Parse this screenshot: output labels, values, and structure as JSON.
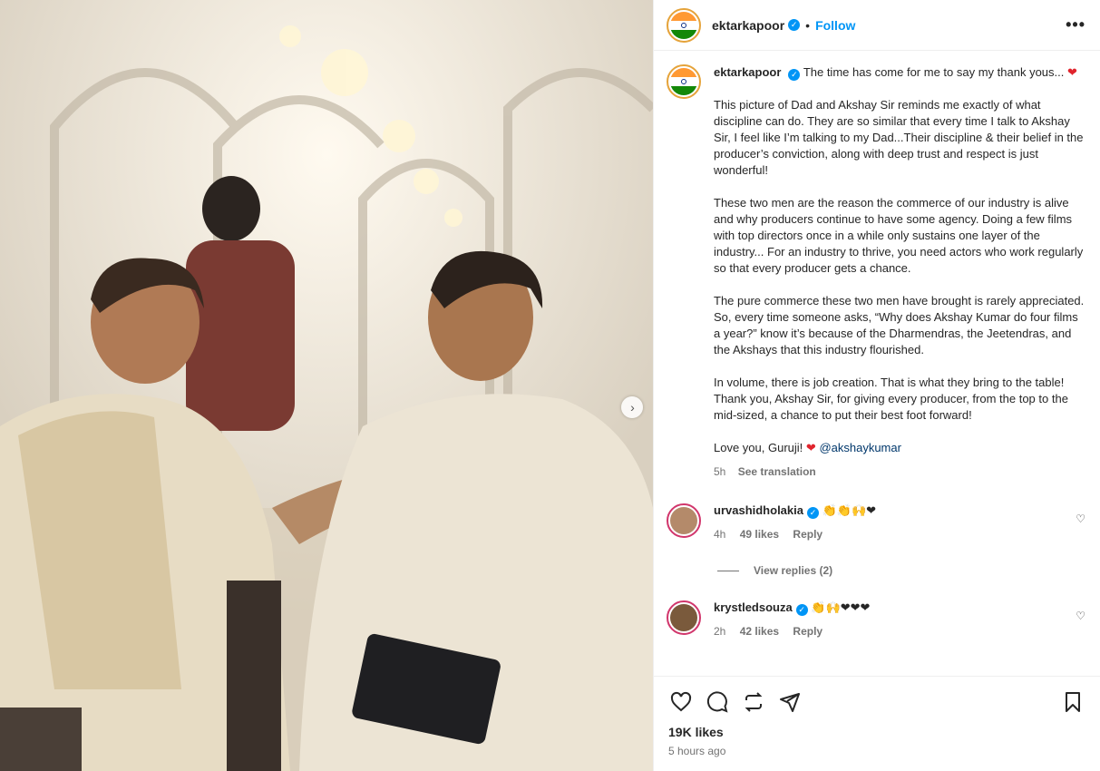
{
  "post": {
    "username": "ektarkapoor",
    "follow_label": "Follow",
    "more_label": "•••",
    "separator": "•"
  },
  "caption": {
    "username": "ektarkapoor",
    "first_line": "The time has come for me to say my thank yous...",
    "heart": "❤",
    "paragraphs": [
      "This picture of Dad and Akshay Sir reminds me exactly of what discipline can do. They are so similar that every time I talk to Akshay Sir, I feel like I’m talking to my Dad...Their discipline & their belief in the producer’s conviction, along with deep trust and respect is just wonderful!",
      "These two men are the reason the commerce of our industry is alive and why producers continue to have some agency. Doing a few films with top directors once in a while only sustains one layer of the industry... For an industry to thrive, you need actors who work regularly so that every producer gets a chance.",
      "The pure commerce these two men have brought is rarely appreciated. So, every time someone asks, “Why does Akshay Kumar do four films a year?” know it’s because of the Dharmendras, the Jeetendras, and the Akshays that this industry flourished.",
      "In volume, there is job creation. That is what they bring to the table! Thank you, Akshay Sir, for giving every producer, from the top to the mid-sized, a chance to put their best foot forward!"
    ],
    "closing": "Love you, Guruji!",
    "mention": "@akshaykumar",
    "age": "5h",
    "see_translation": "See translation"
  },
  "comments": [
    {
      "username": "urvashidholakia",
      "text": "👏👏🙌❤",
      "age": "4h",
      "likes": "49 likes",
      "reply": "Reply",
      "avatar_color": "#b48a6a"
    },
    {
      "username": "krystledsouza",
      "text": "👏🙌❤❤❤",
      "age": "2h",
      "likes": "42 likes",
      "reply": "Reply",
      "avatar_color": "#7a5a3c"
    }
  ],
  "view_replies": "View replies (2)",
  "footer": {
    "likes": "19K likes",
    "time": "5 hours ago"
  },
  "colors": {
    "accent": "#0095f6",
    "heart": "#e0242d",
    "muted": "#737373"
  },
  "icons": [
    "heart-icon",
    "comment-icon",
    "repost-icon",
    "share-icon",
    "bookmark-icon",
    "verified-badge-icon",
    "more-icon",
    "chevron-right-icon"
  ]
}
